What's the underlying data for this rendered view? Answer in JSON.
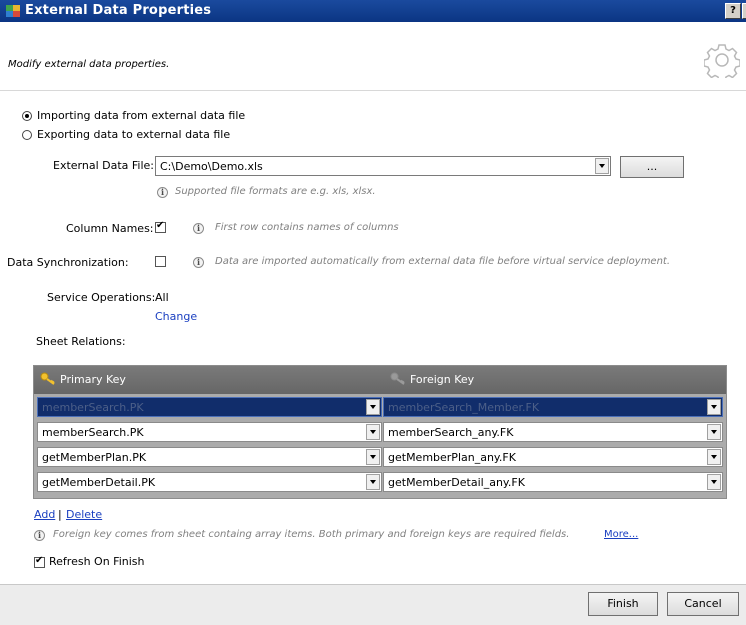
{
  "window": {
    "title": "External Data Properties",
    "help_label": "?",
    "close_label": "X"
  },
  "header": {
    "description": "Modify external data properties."
  },
  "mode": {
    "import_label": "Importing data from external data file",
    "export_label": "Exporting data to external data file",
    "selected": "import"
  },
  "file": {
    "label": "External Data File:",
    "value": "C:\\Demo\\Demo.xls",
    "browse_label": "...",
    "hint": "Supported file formats are e.g. xls, xlsx."
  },
  "column_names": {
    "label": "Column Names:",
    "checked": true,
    "hint": "First row contains names of columns"
  },
  "data_sync": {
    "label": "Data Synchronization:",
    "checked": false,
    "hint": "Data are imported automatically from external data file before virtual service deployment."
  },
  "service_operations": {
    "label": "Service Operations:",
    "value": "All",
    "change_label": "Change"
  },
  "sheet_relations": {
    "label": "Sheet Relations:",
    "columns": [
      "Primary Key",
      "Foreign Key"
    ],
    "rows": [
      {
        "primary": "memberSearch.PK",
        "foreign": "memberSearch_Member.FK"
      },
      {
        "primary": "memberSearch.PK",
        "foreign": "memberSearch_any.FK"
      },
      {
        "primary": "getMemberPlan.PK",
        "foreign": "getMemberPlan_any.FK"
      },
      {
        "primary": "getMemberDetail.PK",
        "foreign": "getMemberDetail_any.FK"
      }
    ],
    "selected_row": 0,
    "add_label": "Add",
    "separator": "|",
    "delete_label": "Delete",
    "hint": "Foreign key comes from sheet containg array items. Both primary and foreign keys are required fields.",
    "more_label": "More..."
  },
  "refresh": {
    "label": "Refresh On Finish",
    "checked": true
  },
  "footer": {
    "finish_label": "Finish",
    "cancel_label": "Cancel"
  },
  "colors": {
    "titlebar": "#0b3583",
    "selected_row": "#112d6b",
    "link": "#1a3fc0",
    "grid_header": "#6e6e6e"
  }
}
